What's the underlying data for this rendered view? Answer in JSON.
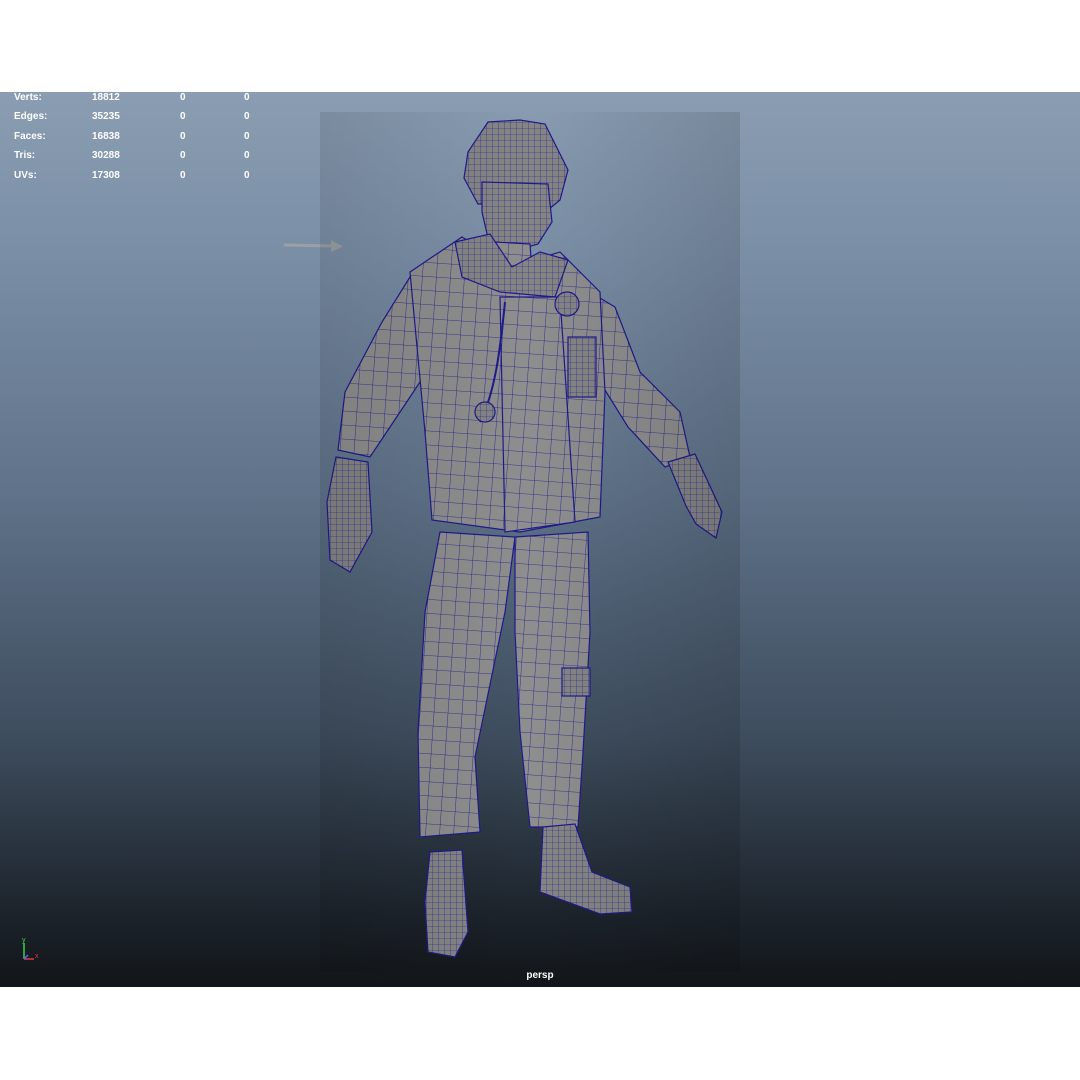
{
  "viewport": {
    "camera": "persp",
    "background_top": "#8a9db2",
    "background_bottom": "#121519",
    "wireframe_color": "#1e1a8c",
    "mesh_color": "#8d8d8d"
  },
  "hud": {
    "rows": [
      {
        "label": "Verts:",
        "v1": "18812",
        "v2": "0",
        "v3": "0"
      },
      {
        "label": "Edges:",
        "v1": "35235",
        "v2": "0",
        "v3": "0"
      },
      {
        "label": "Faces:",
        "v1": "16838",
        "v2": "0",
        "v3": "0"
      },
      {
        "label": "Tris:",
        "v1": "30288",
        "v2": "0",
        "v3": "0"
      },
      {
        "label": "UVs:",
        "v1": "17308",
        "v2": "0",
        "v3": "0"
      }
    ]
  },
  "gizmo": {
    "y_label": "y",
    "x_label": "x",
    "y_color": "#3fd14a",
    "x_color": "#e03a3a"
  },
  "icons": {
    "arrow": "pointer-arrow-icon",
    "gizmo": "axis-gizmo-icon"
  }
}
